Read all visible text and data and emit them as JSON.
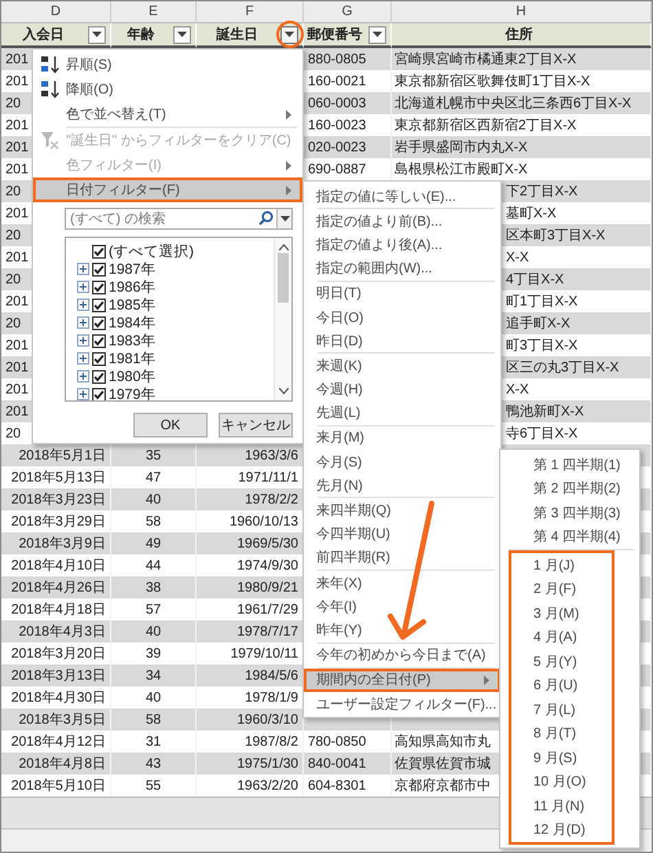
{
  "sheet": {
    "column_letters": [
      "D",
      "E",
      "F",
      "G",
      "H"
    ],
    "columns": [
      {
        "label": "入会日",
        "filter": true,
        "selected": false
      },
      {
        "label": "年齢",
        "filter": true,
        "selected": false
      },
      {
        "label": "誕生日",
        "filter": true,
        "selected": true
      },
      {
        "label": "郵便番号",
        "filter": true,
        "selected": false
      },
      {
        "label": "住所",
        "filter": false,
        "selected": false
      }
    ],
    "rows": [
      {
        "d": "201",
        "d_cut": true,
        "g": "880-0805",
        "h": "宮崎県宮崎市橘通東2丁目X-X",
        "h_cut": false
      },
      {
        "d": "201",
        "d_cut": true,
        "g": "160-0021",
        "h": "東京都新宿区歌舞伎町1丁目X-X",
        "h_cut": false
      },
      {
        "d": "20",
        "d_cut": true,
        "g": "060-0003",
        "h": "北海道札幌市中央区北三条西6丁目X-X",
        "h_cut": false
      },
      {
        "d": "201",
        "d_cut": true,
        "g": "160-0023",
        "h": "東京都新宿区西新宿2丁目X-X",
        "h_cut": false
      },
      {
        "d": "201",
        "d_cut": true,
        "g": "020-0023",
        "h": "岩手県盛岡市内丸X-X",
        "h_cut": false
      },
      {
        "d": "201",
        "d_cut": true,
        "g": "690-0887",
        "h": "島根県松江市殿町X-X",
        "h_cut": false
      },
      {
        "d": "20",
        "d_cut": true,
        "h": "下2丁目X-X",
        "h_cut": true
      },
      {
        "d": "201",
        "d_cut": true,
        "h": "墓町X-X",
        "h_cut": true
      },
      {
        "d": "20",
        "d_cut": true,
        "h": "区本町3丁目X-X",
        "h_cut": true
      },
      {
        "d": "201",
        "d_cut": true,
        "h": "X-X",
        "h_cut": true
      },
      {
        "d": "20",
        "d_cut": true,
        "h": "4丁目X-X",
        "h_cut": true
      },
      {
        "d": "201",
        "d_cut": true,
        "h": "町1丁目X-X",
        "h_cut": true
      },
      {
        "d": "20",
        "d_cut": true,
        "h": "追手町X-X",
        "h_cut": true
      },
      {
        "d": "201",
        "d_cut": true,
        "h": "町3丁目X-X",
        "h_cut": true
      },
      {
        "d": "201",
        "d_cut": true,
        "h": "区三の丸3丁目X-X",
        "h_cut": true
      },
      {
        "d": "201",
        "d_cut": true,
        "h": "X-X",
        "h_cut": true
      },
      {
        "d": "201",
        "d_cut": true,
        "h": "鴨池新町X-X",
        "h_cut": true
      },
      {
        "d": "20",
        "d_cut": true,
        "h": "寺6丁目X-X",
        "h_cut": true
      },
      {
        "d": "2018年5月1日",
        "d_cut": false,
        "e": "35",
        "f": "1963/3/6"
      },
      {
        "d": "2018年5月13日",
        "d_cut": false,
        "e": "47",
        "f": "1971/11/1"
      },
      {
        "d": "2018年3月23日",
        "d_cut": false,
        "e": "40",
        "f": "1978/2/2"
      },
      {
        "d": "2018年3月29日",
        "d_cut": false,
        "e": "58",
        "f": "1960/10/13"
      },
      {
        "d": "2018年3月9日",
        "d_cut": false,
        "e": "49",
        "f": "1969/5/30"
      },
      {
        "d": "2018年4月10日",
        "d_cut": false,
        "e": "44",
        "f": "1974/9/30"
      },
      {
        "d": "2018年4月26日",
        "d_cut": false,
        "e": "38",
        "f": "1980/9/21"
      },
      {
        "d": "2018年4月18日",
        "d_cut": false,
        "e": "57",
        "f": "1961/7/29"
      },
      {
        "d": "2018年4月3日",
        "d_cut": false,
        "e": "40",
        "f": "1978/7/17"
      },
      {
        "d": "2018年3月20日",
        "d_cut": false,
        "e": "39",
        "f": "1979/10/11"
      },
      {
        "d": "2018年3月13日",
        "d_cut": false,
        "e": "34",
        "f": "1984/5/6"
      },
      {
        "d": "2018年4月30日",
        "d_cut": false,
        "e": "40",
        "f": "1978/1/9"
      },
      {
        "d": "2018年3月5日",
        "d_cut": false,
        "e": "58",
        "f": "1960/3/10"
      },
      {
        "d": "2018年4月12日",
        "d_cut": false,
        "e": "31",
        "f": "1987/8/2",
        "g": "780-0850",
        "h": "高知県高知市丸",
        "h_cut": false
      },
      {
        "d": "2018年4月8日",
        "d_cut": false,
        "e": "43",
        "f": "1975/1/30",
        "g": "840-0041",
        "h": "佐賀県佐賀市城",
        "h_cut": false
      },
      {
        "d": "2018年5月10日",
        "d_cut": false,
        "e": "55",
        "f": "1963/2/20",
        "g": "604-8301",
        "h": "京都府京都市中",
        "h_cut": false
      }
    ]
  },
  "filter_menu": {
    "items": [
      {
        "kind": "item",
        "label": "昇順(S)",
        "disabled": false,
        "submenu": false,
        "selected": false
      },
      {
        "kind": "item",
        "label": "降順(O)",
        "disabled": false,
        "submenu": false,
        "selected": false
      },
      {
        "kind": "item",
        "label": "色で並べ替え(T)",
        "disabled": false,
        "submenu": true,
        "selected": false
      },
      {
        "kind": "separator"
      },
      {
        "kind": "item",
        "label": "\"誕生日\" からフィルターをクリア(C)",
        "disabled": true,
        "submenu": false,
        "selected": false
      },
      {
        "kind": "item",
        "label": "色フィルター(I)",
        "disabled": true,
        "submenu": true,
        "selected": false
      },
      {
        "kind": "item",
        "label": "日付フィルター(F)",
        "disabled": false,
        "submenu": true,
        "selected": true
      }
    ],
    "search": {
      "placeholder": "(すべて) の検索"
    },
    "checklist": [
      {
        "label": "(すべて選択)",
        "checked": true,
        "expandable": false
      },
      {
        "label": "1987年",
        "checked": true,
        "expandable": true
      },
      {
        "label": "1986年",
        "checked": true,
        "expandable": true
      },
      {
        "label": "1985年",
        "checked": true,
        "expandable": true
      },
      {
        "label": "1984年",
        "checked": true,
        "expandable": true
      },
      {
        "label": "1983年",
        "checked": true,
        "expandable": true
      },
      {
        "label": "1981年",
        "checked": true,
        "expandable": true
      },
      {
        "label": "1980年",
        "checked": true,
        "expandable": true
      },
      {
        "label": "1979年",
        "checked": true,
        "expandable": true
      }
    ],
    "buttons": [
      "OK",
      "キャンセル"
    ]
  },
  "date_filter_menu": {
    "items": [
      {
        "kind": "item",
        "label": "指定の値に等しい(E)...",
        "submenu": false,
        "selected": false
      },
      {
        "kind": "separator"
      },
      {
        "kind": "item",
        "label": "指定の値より前(B)...",
        "submenu": false,
        "selected": false
      },
      {
        "kind": "item",
        "label": "指定の値より後(A)...",
        "submenu": false,
        "selected": false
      },
      {
        "kind": "item",
        "label": "指定の範囲内(W)...",
        "submenu": false,
        "selected": false
      },
      {
        "kind": "separator"
      },
      {
        "kind": "item",
        "label": "明日(T)",
        "submenu": false,
        "selected": false
      },
      {
        "kind": "item",
        "label": "今日(O)",
        "submenu": false,
        "selected": false
      },
      {
        "kind": "item",
        "label": "昨日(D)",
        "submenu": false,
        "selected": false
      },
      {
        "kind": "separator"
      },
      {
        "kind": "item",
        "label": "来週(K)",
        "submenu": false,
        "selected": false
      },
      {
        "kind": "item",
        "label": "今週(H)",
        "submenu": false,
        "selected": false
      },
      {
        "kind": "item",
        "label": "先週(L)",
        "submenu": false,
        "selected": false
      },
      {
        "kind": "separator"
      },
      {
        "kind": "item",
        "label": "来月(M)",
        "submenu": false,
        "selected": false
      },
      {
        "kind": "item",
        "label": "今月(S)",
        "submenu": false,
        "selected": false
      },
      {
        "kind": "item",
        "label": "先月(N)",
        "submenu": false,
        "selected": false
      },
      {
        "kind": "separator"
      },
      {
        "kind": "item",
        "label": "来四半期(Q)",
        "submenu": false,
        "selected": false
      },
      {
        "kind": "item",
        "label": "今四半期(U)",
        "submenu": false,
        "selected": false
      },
      {
        "kind": "item",
        "label": "前四半期(R)",
        "submenu": false,
        "selected": false
      },
      {
        "kind": "separator"
      },
      {
        "kind": "item",
        "label": "来年(X)",
        "submenu": false,
        "selected": false
      },
      {
        "kind": "item",
        "label": "今年(I)",
        "submenu": false,
        "selected": false
      },
      {
        "kind": "item",
        "label": "昨年(Y)",
        "submenu": false,
        "selected": false
      },
      {
        "kind": "separator"
      },
      {
        "kind": "item",
        "label": "今年の初めから今日まで(A)",
        "submenu": false,
        "selected": false
      },
      {
        "kind": "separator"
      },
      {
        "kind": "item",
        "label": "期間内の全日付(P)",
        "submenu": true,
        "selected": true
      },
      {
        "kind": "item",
        "label": "ユーザー設定フィルター(F)...",
        "submenu": false,
        "selected": false
      }
    ]
  },
  "period_menu": {
    "quarters": [
      "第 1 四半期(1)",
      "第 2 四半期(2)",
      "第 3 四半期(3)",
      "第 4 四半期(4)"
    ],
    "months": [
      "1 月(J)",
      "2 月(F)",
      "3 月(M)",
      "4 月(A)",
      "5 月(Y)",
      "6 月(U)",
      "7 月(L)",
      "8 月(T)",
      "9 月(S)",
      "10 月(O)",
      "11 月(N)",
      "12 月(D)"
    ]
  }
}
